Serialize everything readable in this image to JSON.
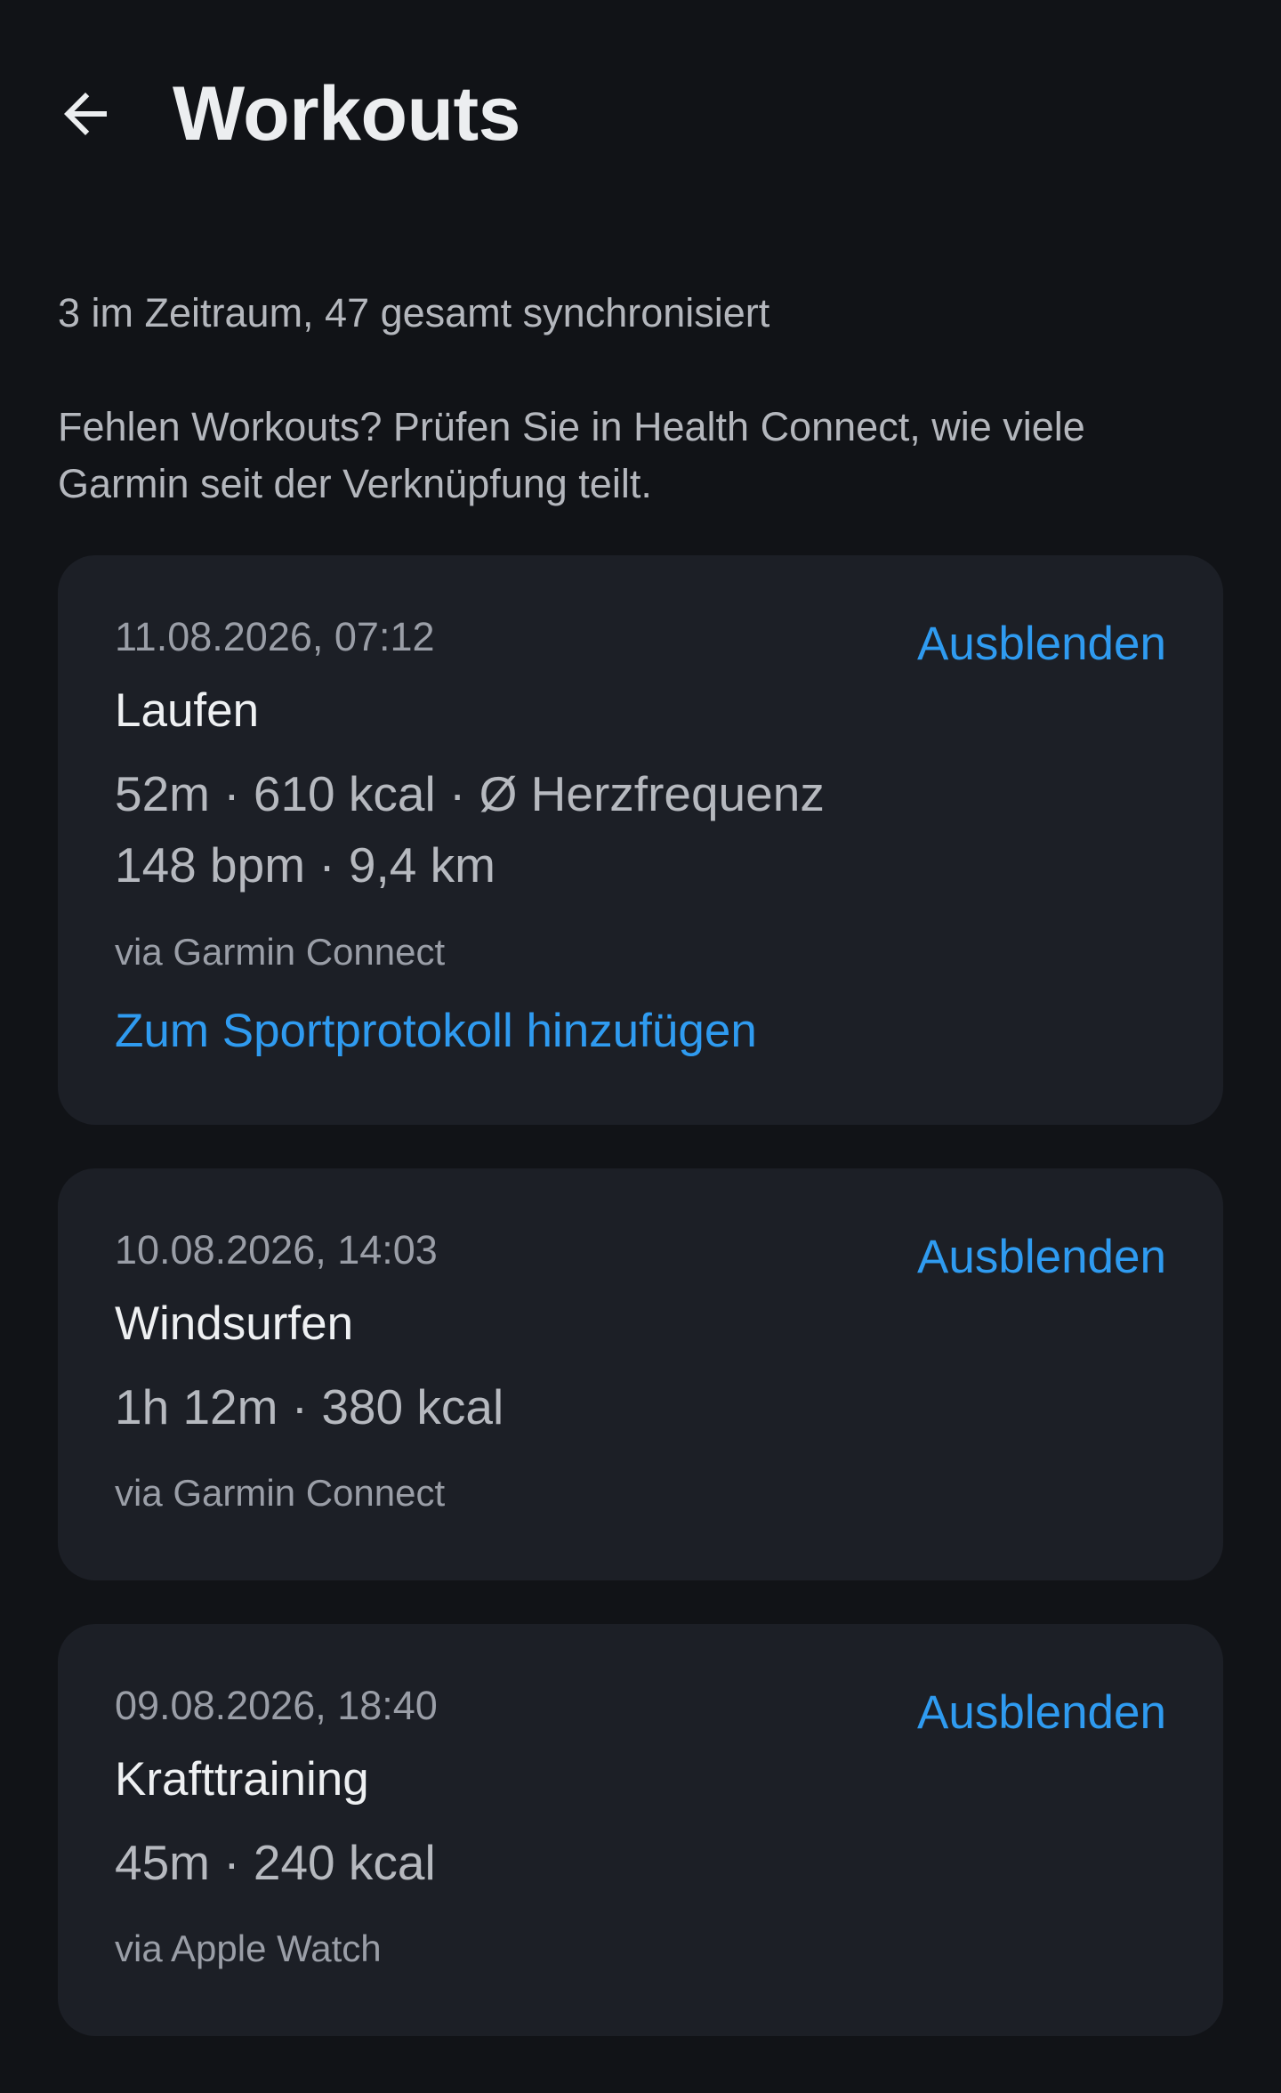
{
  "header": {
    "title": "Workouts",
    "back_icon": "arrow-left-icon"
  },
  "summary": "3 im Zeitraum, 47 gesamt synchronisiert",
  "hint": "Fehlen Workouts? Prüfen Sie in Health Connect, wie viele Garmin seit der Verknüpfung teilt.",
  "colors": {
    "background": "#111317",
    "card": "#1c1f26",
    "accent": "#2f9bf0"
  },
  "workouts": [
    {
      "date": "11.08.2026, 07:12",
      "title": "Laufen",
      "metrics": "52m · 610 kcal · Ø Herzfrequenz 148 bpm · 9,4 km",
      "source": "via Garmin Connect",
      "hide_label": "Ausblenden",
      "action_label": "Zum Sportprotokoll hinzufügen"
    },
    {
      "date": "10.08.2026, 14:03",
      "title": "Windsurfen",
      "metrics": "1h 12m · 380 kcal",
      "source": "via Garmin Connect",
      "hide_label": "Ausblenden"
    },
    {
      "date": "09.08.2026, 18:40",
      "title": "Krafttraining",
      "metrics": "45m · 240 kcal",
      "source": "via Apple Watch",
      "hide_label": "Ausblenden"
    }
  ]
}
